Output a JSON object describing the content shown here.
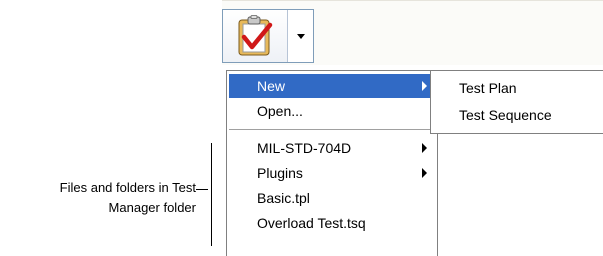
{
  "toolbar": {
    "split_button_icon": "clipboard-checkmark-icon",
    "dropdown_icon": "chevron-down-icon"
  },
  "menu": {
    "items": [
      {
        "label": "New",
        "highlighted": true,
        "has_submenu": true
      },
      {
        "label": "Open...",
        "highlighted": false,
        "has_submenu": false
      },
      {
        "label": "MIL-STD-704D",
        "highlighted": false,
        "has_submenu": true
      },
      {
        "label": "Plugins",
        "highlighted": false,
        "has_submenu": true
      },
      {
        "label": "Basic.tpl",
        "highlighted": false,
        "has_submenu": false
      },
      {
        "label": "Overload Test.tsq",
        "highlighted": false,
        "has_submenu": false
      }
    ],
    "highlight_color": "#316ac5"
  },
  "submenu": {
    "items": [
      {
        "label": "Test Plan"
      },
      {
        "label": "Test Sequence"
      }
    ]
  },
  "callout": {
    "line1": "Files and folders in Test",
    "line2": "Manager folder"
  }
}
